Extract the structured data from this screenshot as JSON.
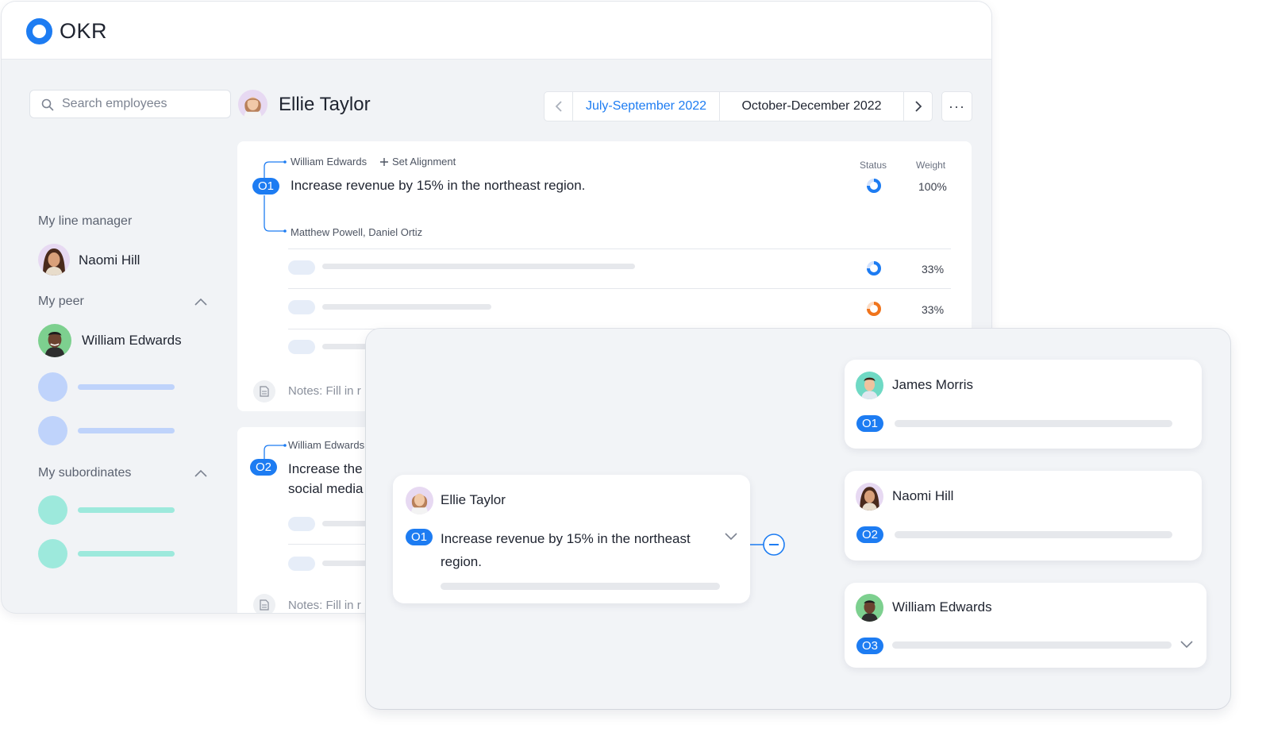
{
  "app": {
    "title": "OKR"
  },
  "search": {
    "placeholder": "Search employees"
  },
  "employee": {
    "name": "Ellie Taylor"
  },
  "periods": {
    "current": "July-September 2022",
    "next": "October-December 2022"
  },
  "more_label": "···",
  "sidebar": {
    "line_manager_heading": "My line manager",
    "line_manager": "Naomi Hill",
    "peer_heading": "My peer",
    "peer": "William Edwards",
    "subordinates_heading": "My subordinates"
  },
  "objectives": [
    {
      "badge": "O1",
      "aligned_to": "William Edwards",
      "set_alignment": "Set Alignment",
      "title": "Increase revenue by 15% in the northeast region.",
      "contributors": "Matthew Powell, Daniel Ortiz",
      "status_label": "Status",
      "weight_label": "Weight",
      "weight": "100%",
      "status_progress": 0.75,
      "key_results": [
        {
          "weight": "33%",
          "status_color": "#1d7cf2",
          "progress": 0.75
        },
        {
          "weight": "33%",
          "status_color": "#f0741c",
          "progress": 0.75
        }
      ],
      "notes": "Notes: Fill in r"
    },
    {
      "badge": "O2",
      "aligned_to": "William Edwards",
      "title_line1": "Increase the",
      "title_line2": "social media",
      "notes": "Notes: Fill in r"
    }
  ],
  "alignment_tree": {
    "root": {
      "name": "Ellie Taylor",
      "badge": "O1",
      "title": "Increase revenue by 15% in the northeast region."
    },
    "children": [
      {
        "name": "James Morris",
        "badge": "O1"
      },
      {
        "name": "Naomi Hill",
        "badge": "O2"
      },
      {
        "name": "William Edwards",
        "badge": "O3"
      }
    ]
  },
  "colors": {
    "accent": "#1d7cf2",
    "warning": "#f0741c",
    "peer_placeholder": "#bfd3fb",
    "subordinate_placeholder": "#9de9dc"
  }
}
